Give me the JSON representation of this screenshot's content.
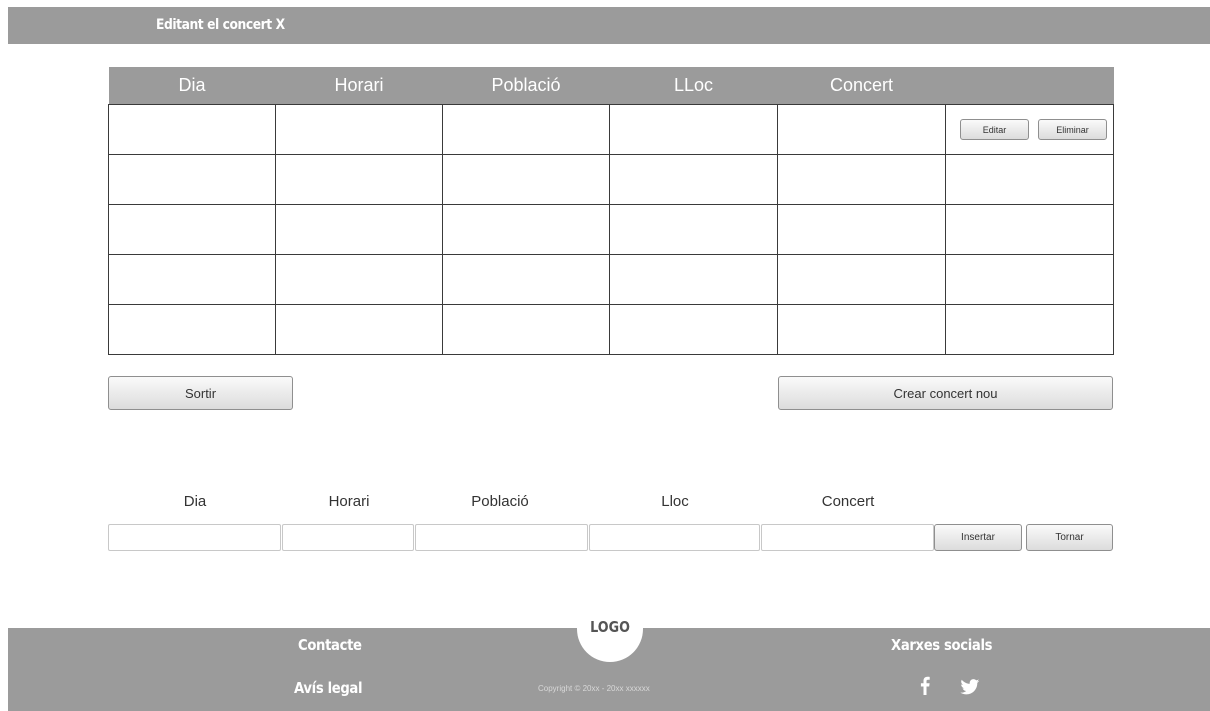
{
  "header": {
    "title": "Editant el concert X"
  },
  "table": {
    "columns": [
      "Dia",
      "Horari",
      "Població",
      "LLoc",
      "Concert",
      ""
    ],
    "rows": [
      {
        "cells": [
          "",
          "",
          "",
          "",
          ""
        ],
        "edit_label": "Editar",
        "delete_label": "Eliminar"
      },
      {
        "cells": [
          "",
          "",
          "",
          "",
          ""
        ]
      },
      {
        "cells": [
          "",
          "",
          "",
          "",
          ""
        ]
      },
      {
        "cells": [
          "",
          "",
          "",
          "",
          ""
        ]
      },
      {
        "cells": [
          "",
          "",
          "",
          "",
          ""
        ]
      }
    ]
  },
  "actions": {
    "exit_label": "Sortir",
    "create_label": "Crear concert nou"
  },
  "form": {
    "labels": {
      "dia": "Dia",
      "horari": "Horari",
      "poblacio": "Població",
      "lloc": "Lloc",
      "concert": "Concert"
    },
    "values": {
      "dia": "",
      "horari": "",
      "poblacio": "",
      "lloc": "",
      "concert": ""
    },
    "insert_label": "Insertar",
    "back_label": "Tornar"
  },
  "footer": {
    "logo_text": "LOGO",
    "contact_label": "Contacte",
    "legal_label": "Avís legal",
    "copyright": "Copyright © 20xx - 20xx xxxxxx",
    "social_label": "Xarxes socials",
    "social_icons": [
      "facebook-icon",
      "twitter-icon"
    ]
  },
  "colors": {
    "bar": "#9b9b9b",
    "border": "#3a3a3a"
  }
}
